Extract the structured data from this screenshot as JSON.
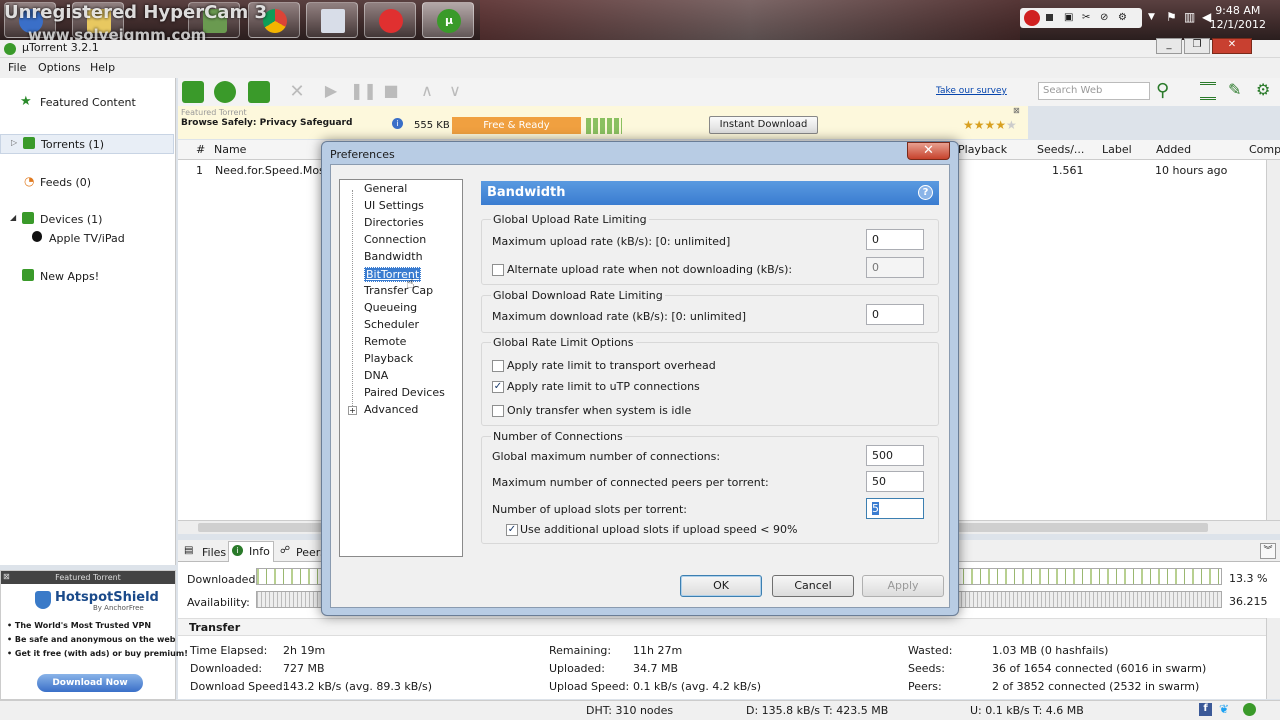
{
  "taskbar": {
    "watermark": "Unregistered HyperCam 3",
    "watermark2": "www.solveigmm.com",
    "clock_time": "9:48 AM",
    "clock_date": "12/1/2012"
  },
  "app": {
    "title": "µTorrent 3.2.1",
    "menu": [
      "File",
      "Options",
      "Help"
    ]
  },
  "sidebar": {
    "featured": "Featured Content",
    "torrents": "Torrents (1)",
    "feeds": "Feeds (0)",
    "devices": "Devices (1)",
    "apple": "Apple TV/iPad",
    "newapps": "New Apps!"
  },
  "toolbar": {
    "survey": "Take our survey",
    "search_placeholder": "Search Web"
  },
  "featured_bar": {
    "label": "Featured Torrent",
    "title": "Browse Safely: Privacy Safeguard",
    "size": "555 KB",
    "status": "Free & Ready",
    "button": "Instant Download"
  },
  "list": {
    "headers": [
      "#",
      "Name",
      "Playback",
      "Seeds/...",
      "Label",
      "Added",
      "Comp"
    ],
    "row": {
      "num": "1",
      "name": "Need.for.Speed.Most",
      "seeds": "1.561",
      "added": "10 hours ago"
    }
  },
  "tabs": [
    "Files",
    "Info",
    "Peers"
  ],
  "info": {
    "downloaded_label": "Downloaded:",
    "availability_label": "Availability:",
    "downloaded_pct": "13.3 %",
    "availability_val": "36.215",
    "transfer_heading": "Transfer",
    "rows": [
      {
        "l1": "Time Elapsed:",
        "v1": "2h 19m",
        "l2": "Remaining:",
        "v2": "11h 27m",
        "l3": "Wasted:",
        "v3": "1.03 MB (0 hashfails)"
      },
      {
        "l1": "Downloaded:",
        "v1": "727 MB",
        "l2": "Uploaded:",
        "v2": "34.7 MB",
        "l3": "Seeds:",
        "v3": "36 of 1654 connected (6016 in swarm)"
      },
      {
        "l1": "Download Speed:",
        "v1": "143.2 kB/s (avg. 89.3 kB/s)",
        "l2": "Upload Speed:",
        "v2": "0.1 kB/s (avg. 4.2 kB/s)",
        "l3": "Peers:",
        "v3": "2 of 3852 connected (2532 in swarm)"
      }
    ]
  },
  "ad": {
    "label": "Featured Torrent",
    "brand": "HotspotShield",
    "sub": "By AnchorFree",
    "bullets": [
      "• The World's Most Trusted VPN",
      "• Be safe and anonymous on the web",
      "• Get it free (with ads) or buy premium!"
    ],
    "button": "Download Now"
  },
  "status": {
    "dht": "DHT: 310 nodes",
    "down": "D: 135.8 kB/s T: 423.5 MB",
    "up": "U: 0.1 kB/s T: 4.6 MB"
  },
  "dialog": {
    "title": "Preferences",
    "close": "✕",
    "tree": [
      "General",
      "UI Settings",
      "Directories",
      "Connection",
      "Bandwidth",
      "BitTorrent",
      "Transfer Cap",
      "Queueing",
      "Scheduler",
      "Remote",
      "Playback",
      "DNA",
      "Paired Devices",
      "Advanced"
    ],
    "pane_title": "Bandwidth",
    "upload_group": "Global Upload Rate Limiting",
    "max_upload_label": "Maximum upload rate (kB/s): [0: unlimited]",
    "max_upload_value": "0",
    "alt_upload_label": "Alternate upload rate when not downloading (kB/s):",
    "alt_upload_value": "0",
    "download_group": "Global Download Rate Limiting",
    "max_download_label": "Maximum download rate (kB/s): [0: unlimited]",
    "max_download_value": "0",
    "options_group": "Global Rate Limit Options",
    "opt1": "Apply rate limit to transport overhead",
    "opt2": "Apply rate limit to uTP connections",
    "opt3": "Only transfer when system is idle",
    "conn_group": "Number of Connections",
    "global_max_label": "Global maximum number of connections:",
    "global_max_value": "500",
    "peers_label": "Maximum number of connected peers per torrent:",
    "peers_value": "50",
    "slots_label": "Number of upload slots per torrent:",
    "slots_value": "5",
    "extra_slots": "Use additional upload slots if upload speed < 90%",
    "ok": "OK",
    "cancel": "Cancel",
    "apply": "Apply"
  }
}
